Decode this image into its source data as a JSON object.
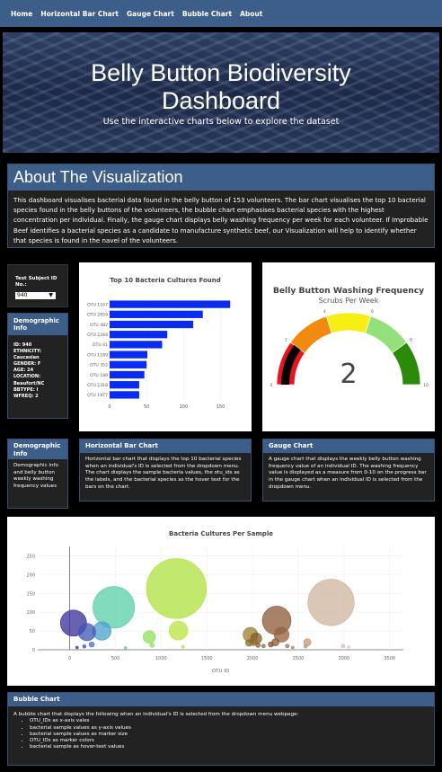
{
  "nav": {
    "items": [
      "Home",
      "Horizontal Bar Chart",
      "Gauge Chart",
      "Bubble Chart",
      "About"
    ]
  },
  "hero": {
    "title_line1": "Belly Button Biodiversity",
    "title_line2": "Dashboard",
    "subtitle": "Use the interactive charts below to explore the dataset"
  },
  "about": {
    "title": "About The Visualization",
    "body": "This dashboard visualises bacterial data found in the belly button of 153 volunteers. The bar chart visualises the top 10 bacterial species found in the belly buttons of the volunteers, the bubble chart emphasises bacterial species with the highest concentration per individual. Finally, the gauge chart displays belly washing frequency per week for each volunteer. If Improbable Beef identifies a bacterial species as a candidate to manufacture synthetic beef, our Visualization will help to identify whether that species is found in the navel of the volunteers."
  },
  "selector": {
    "label": "Test Subject ID No.:",
    "value": "940"
  },
  "demographic": {
    "title": "Demographic Info",
    "lines": [
      "ID: 940",
      "ETHNICITY: Caucasian",
      "GENDER: F",
      "AGE: 24",
      "LOCATION: Beaufort/NC",
      "BBTYPE: I",
      "WFREQ: 2"
    ]
  },
  "colors": {
    "nav": "#3e5e8a",
    "bar": "#0a2bf0",
    "gauge_needle": "#000000"
  },
  "cards": {
    "demo": {
      "title": "Demographic Info",
      "body": "Demographic info and belly button weekly washing frequency values"
    },
    "hbar": {
      "title": "Horizontal Bar Chart",
      "body": "Horizontal bar chart that displays the top 10 bacterial species when an individual's ID is selected from the dropdown menu. The chart displays the sample bacteria values, the otu_ids as the labels, and the bacterial species as the hover text for the bars on the chart."
    },
    "gauge": {
      "title": "Gauge Chart",
      "body": "A gauge chart that displays the weekly belly button washing frequency value of an individual ID. The washing frequency value is displayed as a measure from 0-10 on the progress bar in the gauge chart when an individual ID is selected from the dropdown menu."
    }
  },
  "bubble_summary": {
    "title": "Bubble Chart",
    "intro": "A bubble chart that displays the following when an individual's ID is selected from the dropdown menu webpage:",
    "items": [
      "OTU_IDs as x-axis vales",
      "bacterial sample values as y-axis values",
      "bacterial sample values as marker size",
      "OTU_IDs as marker colors",
      "bacterial sample as hover-text values"
    ]
  },
  "chart_data": [
    {
      "type": "bar",
      "title": "Top 10 Bacteria Cultures Found",
      "orientation": "horizontal",
      "categories": [
        "OTU 1167",
        "OTU 2859",
        "OTU 482",
        "OTU 2264",
        "OTU 41",
        "OTU 1189",
        "OTU 352",
        "OTU 189",
        "OTU 2318",
        "OTU 1977"
      ],
      "values": [
        163,
        126,
        113,
        78,
        71,
        51,
        50,
        47,
        40,
        40
      ],
      "xlim": [
        0,
        170
      ],
      "xticks": [
        "0",
        "50",
        "100",
        "150"
      ]
    },
    {
      "type": "gauge",
      "title": "Belly Button Washing Frequency",
      "subtitle": "Scrubs Per Week",
      "value": 2,
      "range": [
        0,
        10
      ],
      "tick_labels": [
        "0",
        "2",
        "4",
        "6",
        "8",
        "10"
      ],
      "bands": [
        {
          "from": 0,
          "to": 2,
          "color": "#e8141d"
        },
        {
          "from": 2,
          "to": 4,
          "color": "#f28a10"
        },
        {
          "from": 4,
          "to": 6,
          "color": "#f5ef13"
        },
        {
          "from": 6,
          "to": 8,
          "color": "#94e17c"
        },
        {
          "from": 8,
          "to": 10,
          "color": "#2a8a09"
        }
      ]
    },
    {
      "type": "scatter",
      "title": "Bacteria Cultures Per Sample",
      "xlabel": "OTU ID",
      "xlim": [
        -350,
        3650
      ],
      "ylim": [
        0,
        275
      ],
      "xticks": [
        0,
        500,
        1000,
        1500,
        2000,
        2500,
        3000,
        3500
      ],
      "yticks": [
        0,
        50,
        100,
        150,
        200,
        250
      ],
      "points": [
        {
          "x": 41,
          "y": 71,
          "color": "#3a2c9a"
        },
        {
          "x": 189,
          "y": 47,
          "color": "#3e54b4"
        },
        {
          "x": 352,
          "y": 50,
          "color": "#48a0c8"
        },
        {
          "x": 482,
          "y": 113,
          "color": "#5acfa8"
        },
        {
          "x": 240,
          "y": 14,
          "color": "#4a6ad0"
        },
        {
          "x": 160,
          "y": 9,
          "color": "#3f4fae"
        },
        {
          "x": 80,
          "y": 6,
          "color": "#3a3aa0"
        },
        {
          "x": 610,
          "y": 5,
          "color": "#6acfa0"
        },
        {
          "x": 870,
          "y": 34,
          "color": "#8ee05a"
        },
        {
          "x": 900,
          "y": 12,
          "color": "#9ae054"
        },
        {
          "x": 1167,
          "y": 163,
          "color": "#aee23c"
        },
        {
          "x": 1189,
          "y": 51,
          "color": "#b8e43c"
        },
        {
          "x": 1240,
          "y": 8,
          "color": "#bee23c"
        },
        {
          "x": 1977,
          "y": 40,
          "color": "#9c7e2c"
        },
        {
          "x": 1960,
          "y": 18,
          "color": "#8a6a2a"
        },
        {
          "x": 2010,
          "y": 22,
          "color": "#9a6e2e"
        },
        {
          "x": 2040,
          "y": 30,
          "color": "#7e5e28"
        },
        {
          "x": 2060,
          "y": 12,
          "color": "#8c6430"
        },
        {
          "x": 2120,
          "y": 10,
          "color": "#967040"
        },
        {
          "x": 2264,
          "y": 78,
          "color": "#8a5a36"
        },
        {
          "x": 2318,
          "y": 40,
          "color": "#94603a"
        },
        {
          "x": 2200,
          "y": 14,
          "color": "#7a5030"
        },
        {
          "x": 2250,
          "y": 20,
          "color": "#8a5a36"
        },
        {
          "x": 2380,
          "y": 10,
          "color": "#a27452"
        },
        {
          "x": 2440,
          "y": 6,
          "color": "#a88060"
        },
        {
          "x": 2580,
          "y": 9,
          "color": "#b8906e"
        },
        {
          "x": 2600,
          "y": 20,
          "color": "#c09a7c"
        },
        {
          "x": 2859,
          "y": 126,
          "color": "#cdb49e"
        },
        {
          "x": 2990,
          "y": 10,
          "color": "#d6bfae"
        },
        {
          "x": 3050,
          "y": 7,
          "color": "#dcc8b8"
        }
      ]
    }
  ]
}
